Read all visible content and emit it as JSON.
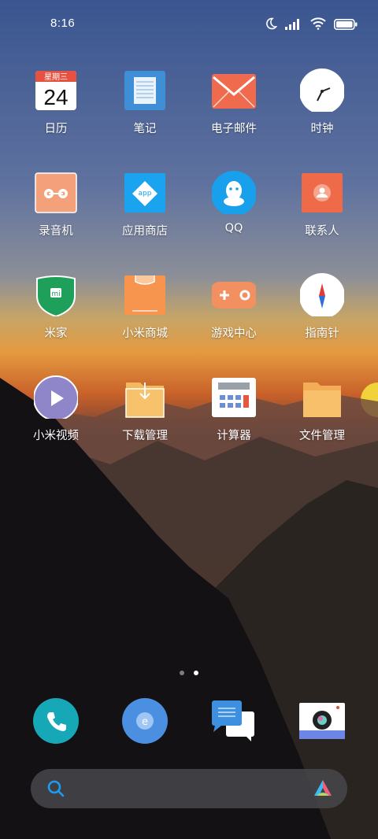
{
  "status": {
    "time": "8:16"
  },
  "apps": [
    {
      "label": "日历",
      "icon": "calendar-icon",
      "calendar_weekday": "星期三",
      "calendar_day": "24"
    },
    {
      "label": "笔记",
      "icon": "notes-icon"
    },
    {
      "label": "电子邮件",
      "icon": "email-icon"
    },
    {
      "label": "时钟",
      "icon": "clock-icon"
    },
    {
      "label": "录音机",
      "icon": "recorder-icon"
    },
    {
      "label": "应用商店",
      "icon": "app-store-icon",
      "badge_text": "app"
    },
    {
      "label": "QQ",
      "icon": "qq-icon"
    },
    {
      "label": "联系人",
      "icon": "contacts-icon"
    },
    {
      "label": "米家",
      "icon": "mijia-icon",
      "badge_text": "mi"
    },
    {
      "label": "小米商城",
      "icon": "mi-store-icon"
    },
    {
      "label": "游戏中心",
      "icon": "game-center-icon"
    },
    {
      "label": "指南针",
      "icon": "compass-icon"
    },
    {
      "label": "小米视频",
      "icon": "video-icon"
    },
    {
      "label": "下载管理",
      "icon": "downloads-icon"
    },
    {
      "label": "计算器",
      "icon": "calculator-icon"
    },
    {
      "label": "文件管理",
      "icon": "file-manager-icon"
    }
  ],
  "dock": [
    {
      "icon": "phone-icon"
    },
    {
      "icon": "browser-icon",
      "badge_text": "e"
    },
    {
      "icon": "messages-icon"
    },
    {
      "icon": "camera-icon"
    }
  ],
  "pages": {
    "count": 2,
    "active": 2
  },
  "colors": {
    "accent_blue": "#1e9bf0",
    "orange": "#f08a4b",
    "folder": "#f8b55a"
  }
}
